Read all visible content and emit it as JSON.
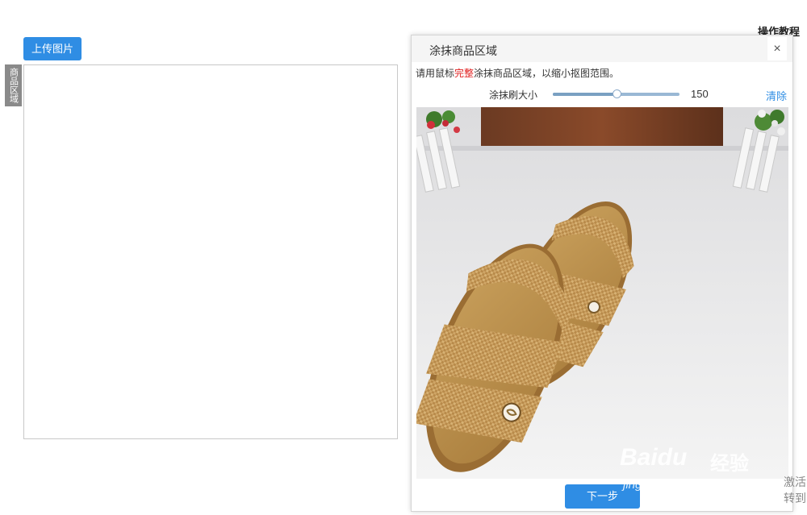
{
  "header": {
    "tutorial_label": "操作教程"
  },
  "toolbar": {
    "upload_label": "上传图片"
  },
  "side_tab": {
    "label": "商品区域"
  },
  "dialog": {
    "title": "涂抹商品区域",
    "close_label": "×",
    "instruction_before": "请用鼠标",
    "instruction_highlight": "完整",
    "instruction_after": "涂抹商品区域，以缩小抠图范围。",
    "brush_label": "涂抹刷大小",
    "brush_value": "150",
    "brush_level": 0.5,
    "clear_label": "清除",
    "next_label": "下一步"
  },
  "watermark": {
    "brand": "Baidu",
    "brand_cn": "经验",
    "url": "jingyan.baidu.com"
  },
  "activation": {
    "line1": "激活",
    "line2": "转到"
  },
  "colors": {
    "primary": "#2f8de4",
    "highlight": "#e02020",
    "side_tab": "#8a8a8a"
  }
}
